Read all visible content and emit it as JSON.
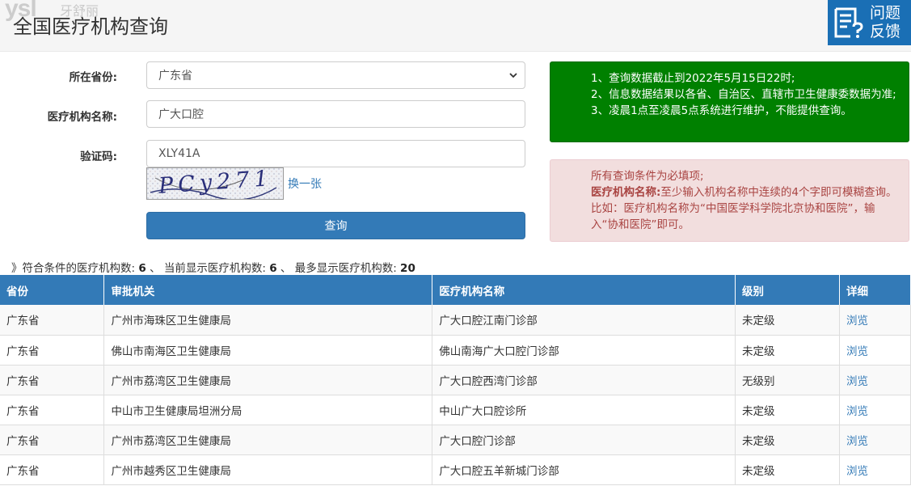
{
  "watermark": {
    "logo": "ysl",
    "sub": "牙舒丽"
  },
  "page_title": "全国医疗机构查询",
  "feedback": {
    "line1": "问题",
    "line2": "反馈"
  },
  "form": {
    "province_label": "所在省份:",
    "province_value": "广东省",
    "name_label": "医疗机构名称:",
    "name_value": "广大口腔",
    "captcha_label": "验证码:",
    "captcha_value": "XLY41A",
    "captcha_image_text": "PCy271",
    "captcha_refresh": "换一张",
    "submit": "查询"
  },
  "notice_green": [
    "1、查询数据截止到2022年5月15日22时;",
    "2、信息数据结果以各省、自治区、直辖市卫生健康委数据为准;",
    "3、凌晨1点至凌晨5点系统进行维护，不能提供查询。"
  ],
  "notice_pink": {
    "line1": "所有查询条件为必填项;",
    "bold_label": "医疗机构名称:",
    "line2": "至少输入机构名称中连续的4个字即可模糊查询。比如：医疗机构名称为“中国医学科学院北京协和医院”，输入“协和医院”即可。"
  },
  "summary": {
    "prefix": "》符合条件的医疗机构数:",
    "matched": "6",
    "sep1": "、 当前显示医疗机构数:",
    "shown": "6",
    "sep2": "、 最多显示医疗机构数:",
    "max": "20"
  },
  "table": {
    "headers": [
      "省份",
      "审批机关",
      "医疗机构名称",
      "级别",
      "详细"
    ],
    "rows": [
      [
        "广东省",
        "广州市海珠区卫生健康局",
        "广大口腔江南门诊部",
        "未定级",
        "浏览"
      ],
      [
        "广东省",
        "佛山市南海区卫生健康局",
        "佛山南海广大口腔门诊部",
        "未定级",
        "浏览"
      ],
      [
        "广东省",
        "广州市荔湾区卫生健康局",
        "广大口腔西湾门诊部",
        "无级别",
        "浏览"
      ],
      [
        "广东省",
        "中山市卫生健康局坦洲分局",
        "中山广大口腔诊所",
        "未定级",
        "浏览"
      ],
      [
        "广东省",
        "广州市荔湾区卫生健康局",
        "广大口腔门诊部",
        "未定级",
        "浏览"
      ],
      [
        "广东省",
        "广州市越秀区卫生健康局",
        "广大口腔五羊新城门诊部",
        "未定级",
        "浏览"
      ]
    ]
  },
  "colors": {
    "primary": "#337ab7",
    "notice_green": "#008000",
    "notice_pink_bg": "#f2dede",
    "notice_pink_text": "#a94442"
  }
}
